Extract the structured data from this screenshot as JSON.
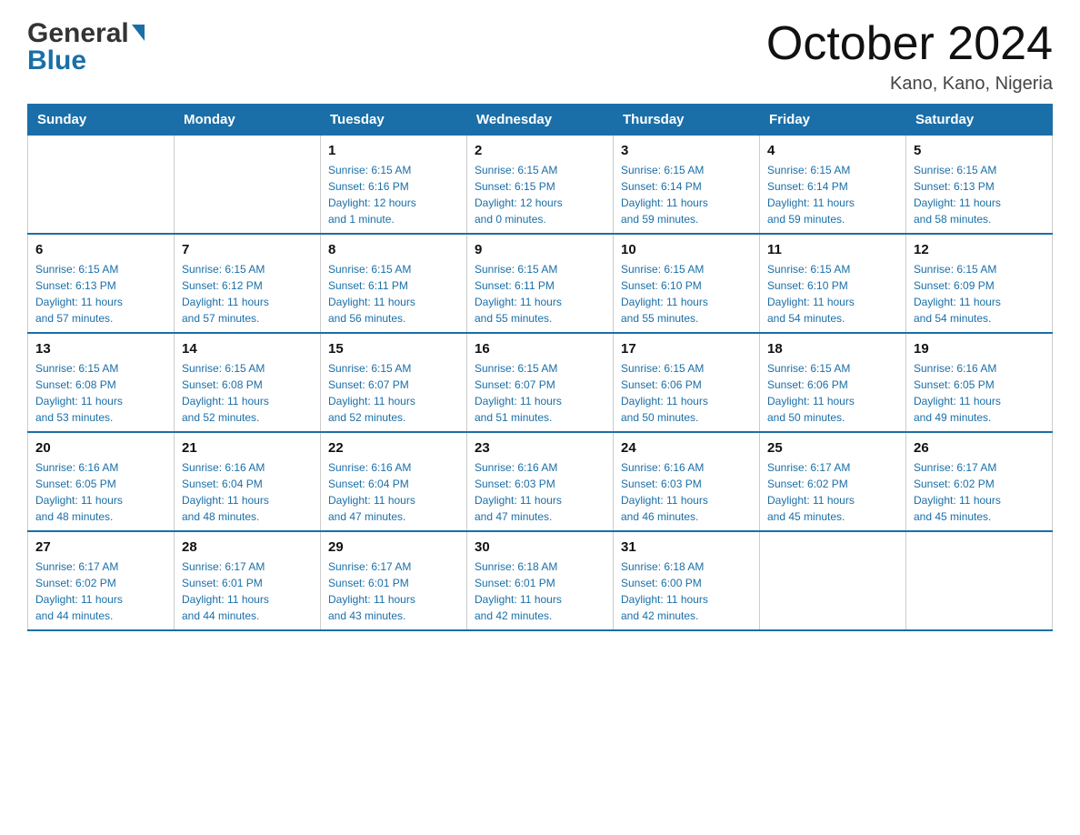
{
  "logo": {
    "general": "General",
    "blue": "Blue"
  },
  "header": {
    "month_year": "October 2024",
    "location": "Kano, Kano, Nigeria"
  },
  "days_of_week": [
    "Sunday",
    "Monday",
    "Tuesday",
    "Wednesday",
    "Thursday",
    "Friday",
    "Saturday"
  ],
  "weeks": [
    [
      {
        "day": "",
        "info": ""
      },
      {
        "day": "",
        "info": ""
      },
      {
        "day": "1",
        "info": "Sunrise: 6:15 AM\nSunset: 6:16 PM\nDaylight: 12 hours\nand 1 minute."
      },
      {
        "day": "2",
        "info": "Sunrise: 6:15 AM\nSunset: 6:15 PM\nDaylight: 12 hours\nand 0 minutes."
      },
      {
        "day": "3",
        "info": "Sunrise: 6:15 AM\nSunset: 6:14 PM\nDaylight: 11 hours\nand 59 minutes."
      },
      {
        "day": "4",
        "info": "Sunrise: 6:15 AM\nSunset: 6:14 PM\nDaylight: 11 hours\nand 59 minutes."
      },
      {
        "day": "5",
        "info": "Sunrise: 6:15 AM\nSunset: 6:13 PM\nDaylight: 11 hours\nand 58 minutes."
      }
    ],
    [
      {
        "day": "6",
        "info": "Sunrise: 6:15 AM\nSunset: 6:13 PM\nDaylight: 11 hours\nand 57 minutes."
      },
      {
        "day": "7",
        "info": "Sunrise: 6:15 AM\nSunset: 6:12 PM\nDaylight: 11 hours\nand 57 minutes."
      },
      {
        "day": "8",
        "info": "Sunrise: 6:15 AM\nSunset: 6:11 PM\nDaylight: 11 hours\nand 56 minutes."
      },
      {
        "day": "9",
        "info": "Sunrise: 6:15 AM\nSunset: 6:11 PM\nDaylight: 11 hours\nand 55 minutes."
      },
      {
        "day": "10",
        "info": "Sunrise: 6:15 AM\nSunset: 6:10 PM\nDaylight: 11 hours\nand 55 minutes."
      },
      {
        "day": "11",
        "info": "Sunrise: 6:15 AM\nSunset: 6:10 PM\nDaylight: 11 hours\nand 54 minutes."
      },
      {
        "day": "12",
        "info": "Sunrise: 6:15 AM\nSunset: 6:09 PM\nDaylight: 11 hours\nand 54 minutes."
      }
    ],
    [
      {
        "day": "13",
        "info": "Sunrise: 6:15 AM\nSunset: 6:08 PM\nDaylight: 11 hours\nand 53 minutes."
      },
      {
        "day": "14",
        "info": "Sunrise: 6:15 AM\nSunset: 6:08 PM\nDaylight: 11 hours\nand 52 minutes."
      },
      {
        "day": "15",
        "info": "Sunrise: 6:15 AM\nSunset: 6:07 PM\nDaylight: 11 hours\nand 52 minutes."
      },
      {
        "day": "16",
        "info": "Sunrise: 6:15 AM\nSunset: 6:07 PM\nDaylight: 11 hours\nand 51 minutes."
      },
      {
        "day": "17",
        "info": "Sunrise: 6:15 AM\nSunset: 6:06 PM\nDaylight: 11 hours\nand 50 minutes."
      },
      {
        "day": "18",
        "info": "Sunrise: 6:15 AM\nSunset: 6:06 PM\nDaylight: 11 hours\nand 50 minutes."
      },
      {
        "day": "19",
        "info": "Sunrise: 6:16 AM\nSunset: 6:05 PM\nDaylight: 11 hours\nand 49 minutes."
      }
    ],
    [
      {
        "day": "20",
        "info": "Sunrise: 6:16 AM\nSunset: 6:05 PM\nDaylight: 11 hours\nand 48 minutes."
      },
      {
        "day": "21",
        "info": "Sunrise: 6:16 AM\nSunset: 6:04 PM\nDaylight: 11 hours\nand 48 minutes."
      },
      {
        "day": "22",
        "info": "Sunrise: 6:16 AM\nSunset: 6:04 PM\nDaylight: 11 hours\nand 47 minutes."
      },
      {
        "day": "23",
        "info": "Sunrise: 6:16 AM\nSunset: 6:03 PM\nDaylight: 11 hours\nand 47 minutes."
      },
      {
        "day": "24",
        "info": "Sunrise: 6:16 AM\nSunset: 6:03 PM\nDaylight: 11 hours\nand 46 minutes."
      },
      {
        "day": "25",
        "info": "Sunrise: 6:17 AM\nSunset: 6:02 PM\nDaylight: 11 hours\nand 45 minutes."
      },
      {
        "day": "26",
        "info": "Sunrise: 6:17 AM\nSunset: 6:02 PM\nDaylight: 11 hours\nand 45 minutes."
      }
    ],
    [
      {
        "day": "27",
        "info": "Sunrise: 6:17 AM\nSunset: 6:02 PM\nDaylight: 11 hours\nand 44 minutes."
      },
      {
        "day": "28",
        "info": "Sunrise: 6:17 AM\nSunset: 6:01 PM\nDaylight: 11 hours\nand 44 minutes."
      },
      {
        "day": "29",
        "info": "Sunrise: 6:17 AM\nSunset: 6:01 PM\nDaylight: 11 hours\nand 43 minutes."
      },
      {
        "day": "30",
        "info": "Sunrise: 6:18 AM\nSunset: 6:01 PM\nDaylight: 11 hours\nand 42 minutes."
      },
      {
        "day": "31",
        "info": "Sunrise: 6:18 AM\nSunset: 6:00 PM\nDaylight: 11 hours\nand 42 minutes."
      },
      {
        "day": "",
        "info": ""
      },
      {
        "day": "",
        "info": ""
      }
    ]
  ]
}
